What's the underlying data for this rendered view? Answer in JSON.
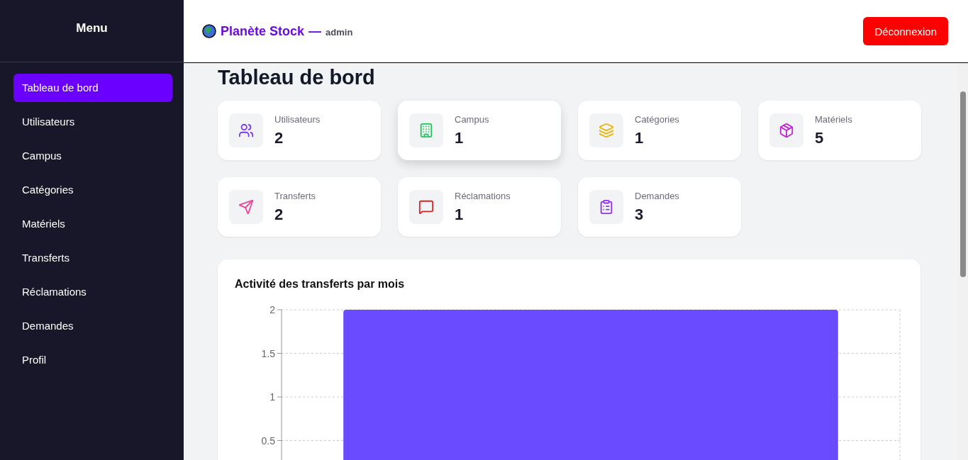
{
  "sidebar": {
    "title": "Menu",
    "items": [
      {
        "label": "Tableau de bord",
        "selected": true
      },
      {
        "label": "Utilisateurs",
        "selected": false
      },
      {
        "label": "Campus",
        "selected": false
      },
      {
        "label": "Catégories",
        "selected": false
      },
      {
        "label": "Matériels",
        "selected": false
      },
      {
        "label": "Transferts",
        "selected": false
      },
      {
        "label": "Réclamations",
        "selected": false
      },
      {
        "label": "Demandes",
        "selected": false
      },
      {
        "label": "Profil",
        "selected": false
      }
    ]
  },
  "header": {
    "app_name": "Planète Stock",
    "separator": "—",
    "user": "admin",
    "logout_button": "Déconnexion"
  },
  "page_title": "Tableau de bord",
  "stats": [
    {
      "kind": "users",
      "label": "Utilisateurs",
      "value": "2",
      "color": "#7c3aed",
      "hovered": false
    },
    {
      "kind": "building",
      "label": "Campus",
      "value": "1",
      "color": "#22c55e",
      "hovered": true
    },
    {
      "kind": "layers",
      "label": "Catégories",
      "value": "1",
      "color": "#eab308",
      "hovered": false
    },
    {
      "kind": "package",
      "label": "Matériels",
      "value": "5",
      "color": "#c026d3",
      "hovered": false
    },
    {
      "kind": "send",
      "label": "Transferts",
      "value": "2",
      "color": "#ec4899",
      "hovered": false
    },
    {
      "kind": "message",
      "label": "Réclamations",
      "value": "1",
      "color": "#dc2626",
      "hovered": false
    },
    {
      "kind": "clipboard",
      "label": "Demandes",
      "value": "3",
      "color": "#9333ea",
      "hovered": false
    }
  ],
  "chart": {
    "chart_data": {
      "type": "bar",
      "title": "Activité des transferts par mois",
      "grid": true,
      "ylim": [
        0,
        2
      ],
      "yticks": [
        0.5,
        1,
        1.5,
        2
      ],
      "series": [
        {
          "color": "#6a4bff",
          "values": [
            2
          ]
        }
      ]
    }
  }
}
